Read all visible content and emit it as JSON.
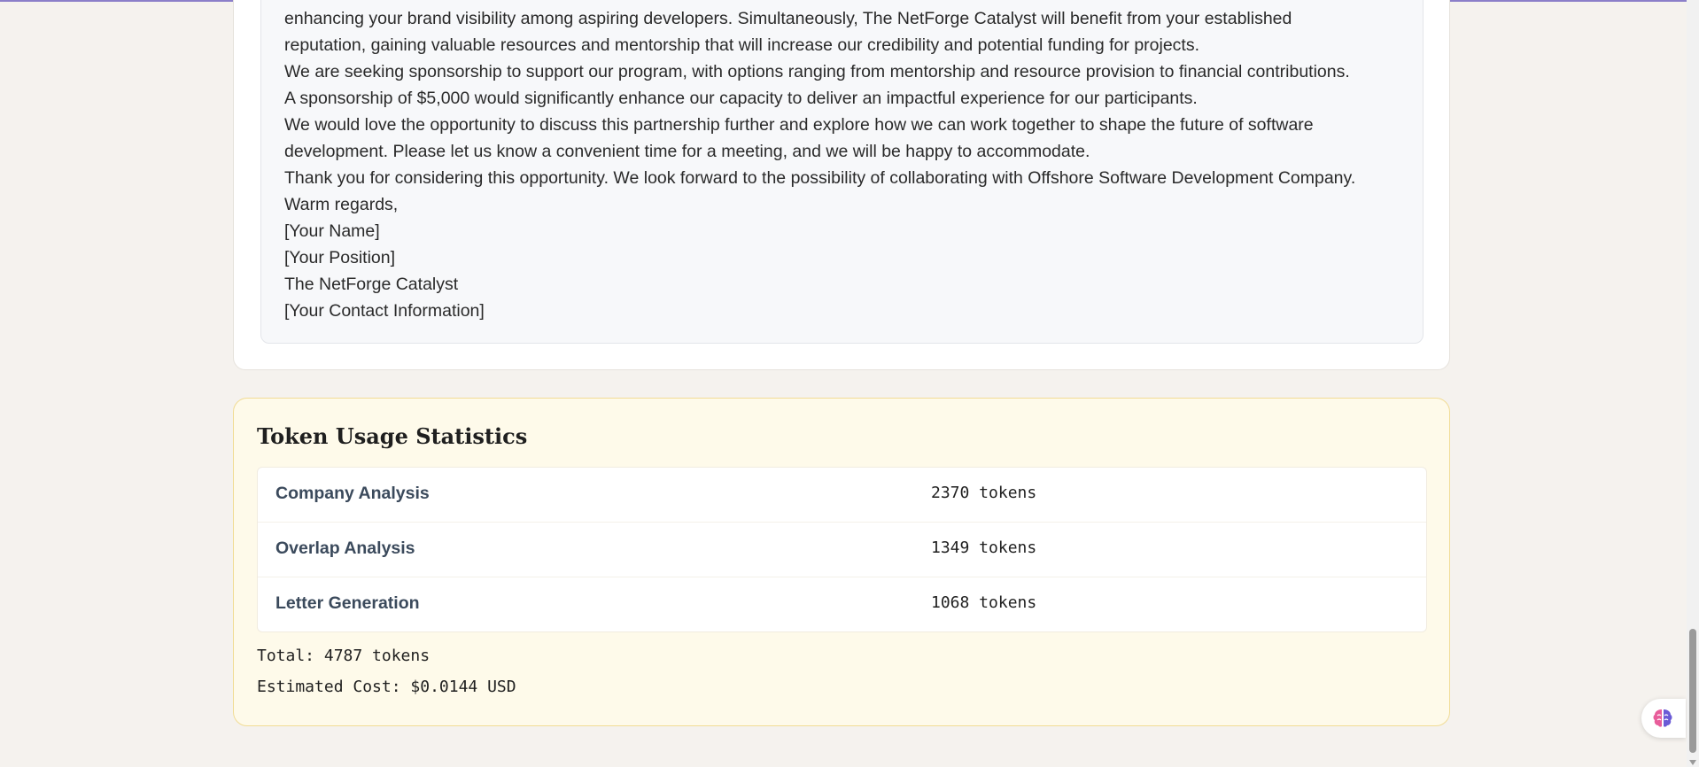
{
  "letter": {
    "lines": [
      "enhancing your brand visibility among aspiring developers. Simultaneously, The NetForge Catalyst will benefit from your established",
      "reputation, gaining valuable resources and mentorship that will increase our credibility and potential funding for projects.",
      "We are seeking sponsorship to support our program, with options ranging from mentorship and resource provision to financial contributions.",
      "A sponsorship of $5,000 would significantly enhance our capacity to deliver an impactful experience for our participants.",
      "We would love the opportunity to discuss this partnership further and explore how we can work together to shape the future of software",
      "development. Please let us know a convenient time for a meeting, and we will be happy to accommodate.",
      "Thank you for considering this opportunity. We look forward to the possibility of collaborating with Offshore Software Development Company.",
      "Warm regards,",
      "[Your Name]",
      "[Your Position]",
      "The NetForge Catalyst",
      "[Your Contact Information]"
    ]
  },
  "token_stats": {
    "title": "Token Usage Statistics",
    "rows": [
      {
        "label": "Company Analysis",
        "value": "2370 tokens"
      },
      {
        "label": "Overlap Analysis",
        "value": "1349 tokens"
      },
      {
        "label": "Letter Generation",
        "value": "1068 tokens"
      }
    ],
    "total": "Total: 4787 tokens",
    "cost": "Estimated Cost: $0.0144 USD"
  },
  "icons": {
    "assistant": "brain-icon"
  },
  "colors": {
    "page_bg": "#f5f2ee",
    "stats_bg": "#fefaea",
    "stats_border": "#f1dc95",
    "label_color": "#3b4a5c"
  }
}
